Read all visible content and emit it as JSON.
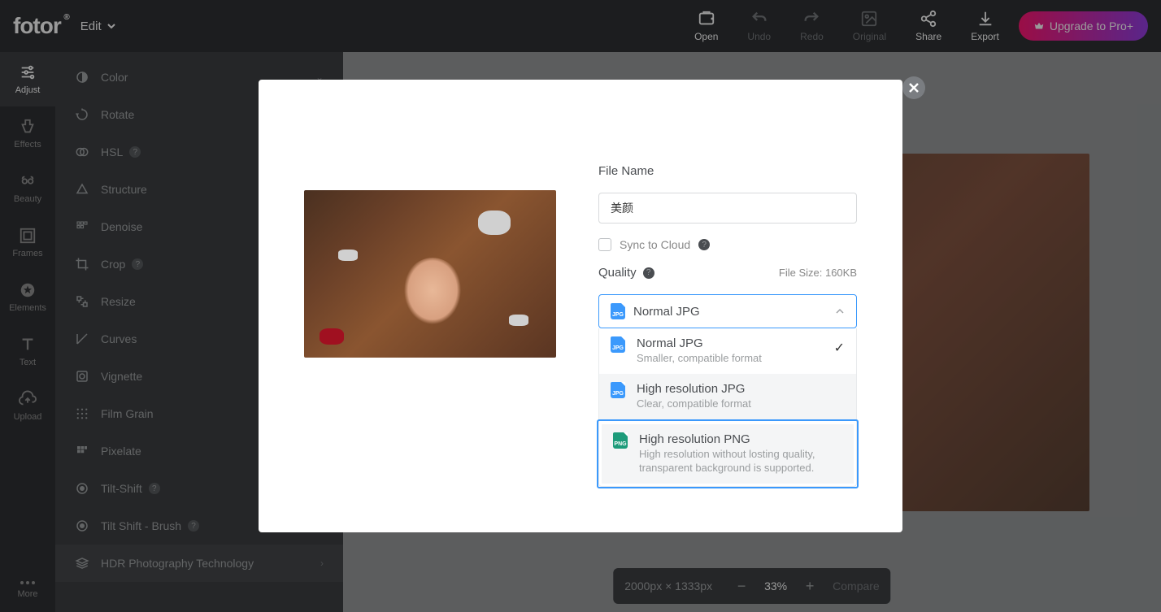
{
  "header": {
    "logo": "fotor",
    "edit_menu": "Edit",
    "tools": {
      "open": "Open",
      "undo": "Undo",
      "redo": "Redo",
      "original": "Original",
      "share": "Share",
      "export": "Export"
    },
    "upgrade": "Upgrade to Pro+"
  },
  "left_toolbar": [
    {
      "key": "adjust",
      "label": "Adjust"
    },
    {
      "key": "effects",
      "label": "Effects"
    },
    {
      "key": "beauty",
      "label": "Beauty"
    },
    {
      "key": "frames",
      "label": "Frames"
    },
    {
      "key": "elements",
      "label": "Elements"
    },
    {
      "key": "text",
      "label": "Text"
    },
    {
      "key": "upload",
      "label": "Upload"
    }
  ],
  "more_label": "More",
  "side_panel": [
    {
      "label": "Color",
      "premium": false,
      "help": false
    },
    {
      "label": "Rotate",
      "premium": false,
      "help": false
    },
    {
      "label": "HSL",
      "premium": true,
      "help": true
    },
    {
      "label": "Structure",
      "premium": true,
      "help": false
    },
    {
      "label": "Denoise",
      "premium": true,
      "help": false
    },
    {
      "label": "Crop",
      "premium": false,
      "help": true
    },
    {
      "label": "Resize",
      "premium": false,
      "help": false
    },
    {
      "label": "Curves",
      "premium": false,
      "help": false
    },
    {
      "label": "Vignette",
      "premium": false,
      "help": false
    },
    {
      "label": "Film Grain",
      "premium": false,
      "help": false
    },
    {
      "label": "Pixelate",
      "premium": false,
      "help": false
    },
    {
      "label": "Tilt-Shift",
      "premium": false,
      "help": true
    },
    {
      "label": "Tilt Shift - Brush",
      "premium": true,
      "help": true
    },
    {
      "label": "HDR Photography Technology",
      "premium": false,
      "help": false,
      "highlighted": true
    }
  ],
  "bottom_bar": {
    "dimensions": "2000px × 1333px",
    "zoom": "33%",
    "compare": "Compare"
  },
  "modal": {
    "file_name_label": "File Name",
    "file_name_value": "美颜",
    "sync_label": "Sync to Cloud",
    "quality_label": "Quality",
    "file_size": "File Size: 160KB",
    "selected": "Normal JPG",
    "options": [
      {
        "title": "Normal JPG",
        "sub": "Smaller, compatible format",
        "type": "jpg",
        "checked": true
      },
      {
        "title": "High resolution JPG",
        "sub": "Clear, compatible format",
        "type": "jpg",
        "checked": false
      },
      {
        "title": "High resolution PNG",
        "sub": "High resolution without losting quality, transparent background is supported.",
        "type": "png",
        "checked": false
      }
    ]
  }
}
